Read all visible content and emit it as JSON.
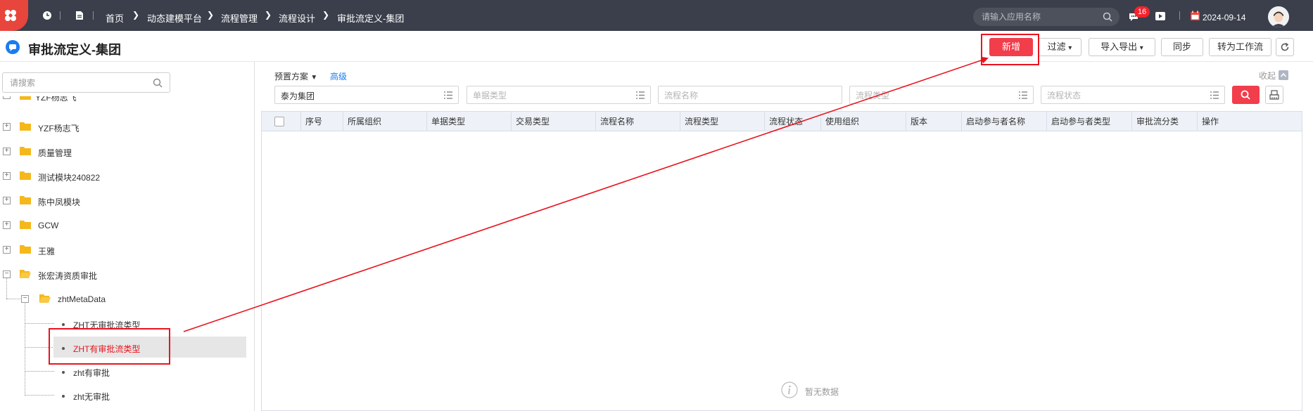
{
  "topbar": {
    "breadcrumbs": [
      "首页",
      "动态建模平台",
      "流程管理",
      "流程设计",
      "审批流定义-集团"
    ],
    "app_search_placeholder": "请输入应用名称",
    "notification_count": "16",
    "date": "2024-09-14"
  },
  "title_bar": {
    "page_title": "审批流定义-集团",
    "buttons": {
      "add": "新增",
      "filter": "过滤",
      "import_export": "导入导出",
      "sync": "同步",
      "to_workflow": "转为工作流"
    }
  },
  "tree": {
    "search_placeholder": "请搜索",
    "partial_top": "YZF杨志飞",
    "nodes": [
      {
        "label": "YZF杨志飞",
        "toggle": "+"
      },
      {
        "label": "质量管理",
        "toggle": "+"
      },
      {
        "label": "测试模块240822",
        "toggle": "+"
      },
      {
        "label": "陈中凤模块",
        "toggle": "+"
      },
      {
        "label": "GCW",
        "toggle": "+"
      },
      {
        "label": "王雅",
        "toggle": "+"
      },
      {
        "label": "张宏涛资质审批",
        "toggle": "−"
      }
    ],
    "child_folder": {
      "label": "zhtMetaData",
      "toggle": "−"
    },
    "leaves": [
      "ZHT无审批流类型",
      "ZHT有审批流类型",
      "zht有审批",
      "zht无审批"
    ],
    "selected_leaf": "ZHT有审批流类型"
  },
  "filters": {
    "preset_label": "预置方案",
    "advanced_label": "高级",
    "collapse_label": "收起",
    "org_value": "泰为集团",
    "doc_type_placeholder": "单据类型",
    "flow_name_placeholder": "流程名称",
    "flow_type_placeholder": "流程类型",
    "flow_status_placeholder": "流程状态"
  },
  "table": {
    "columns": [
      "序号",
      "所属组织",
      "单据类型",
      "交易类型",
      "流程名称",
      "流程类型",
      "流程状态",
      "使用组织",
      "版本",
      "启动参与者名称",
      "启动参与者类型",
      "审批流分类",
      "操作"
    ],
    "rows": [],
    "empty_text": "暂无数据"
  },
  "colors": {
    "topbar_bg": "#3a3f4b",
    "primary_red": "#f23d4b",
    "annotation_red": "#e8141e",
    "link_blue": "#1a7cf0",
    "folder_yellow": "#f5b81c"
  }
}
